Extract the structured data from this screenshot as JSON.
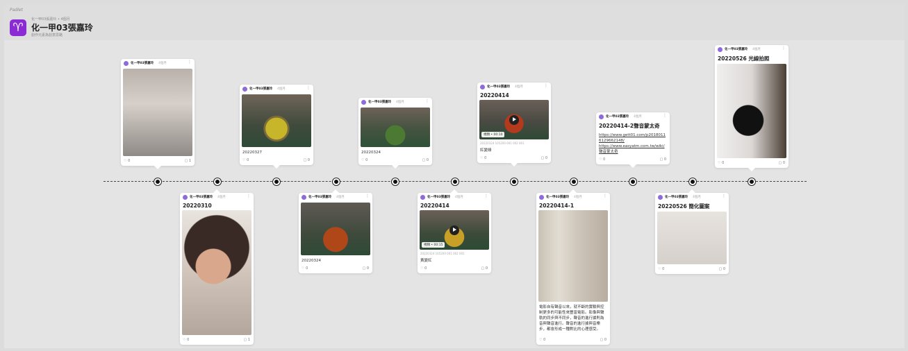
{
  "app": {
    "brand": "Padlet",
    "breadcrumb": "化一甲03張嘉玲 • 4個月",
    "title": "化一甲03張嘉玲",
    "subtitle": "創作元素為創意思路",
    "icon": "aries-icon",
    "icon_glyph": "♈",
    "accent_color": "#8b2bd6"
  },
  "post_common": {
    "author": "化一甲03張嘉玲",
    "time": "4個月",
    "more": "⋮"
  },
  "posts": [
    {
      "title": "",
      "caption": "",
      "likes": "0",
      "comments": "1"
    },
    {
      "title": "20220310",
      "caption": "",
      "likes": "0",
      "comments": "1"
    },
    {
      "title": "",
      "caption": "20220327",
      "likes": "0",
      "comments": "0"
    },
    {
      "title": "",
      "caption": "20220324",
      "likes": "0",
      "comments": "0"
    },
    {
      "title": "",
      "caption": "20220324",
      "likes": "0",
      "comments": "0"
    },
    {
      "title": "20220414",
      "video_meta": "視頻 • 00:15",
      "sub": "20220324 105200 001 002 001",
      "caption": "黃變紅",
      "likes": "0",
      "comments": "0"
    },
    {
      "title": "20220414",
      "video_meta": "視頻 • 00:10",
      "sub": "20220324 105200 001 002 001",
      "caption": "紅變綠",
      "likes": "0",
      "comments": "0"
    },
    {
      "title": "20220414-1",
      "caption": "電影自有聲音以來，就不斷的實驗與控制更多的可能性來豐富電影。影像與聲軌的同步與不同步，聲音的進行據則為音與聲音進行。聲音的進行據與音樂步，都會形成一種對比的心理感受。",
      "likes": "0",
      "comments": "0"
    },
    {
      "title": "20220414-2聲音蒙太奇",
      "links": [
        "https://www.gett01.com/p2018011 6129662148/",
        "https://www.easyatm.com.tw/wiki/ 聲音蒙太奇"
      ],
      "likes": "0",
      "comments": "0"
    },
    {
      "title": "20220526 簡化圖案",
      "caption": "",
      "likes": "0",
      "comments": "0"
    },
    {
      "title": "20220526 光線拍照",
      "caption": "",
      "likes": "0",
      "comments": "0"
    }
  ],
  "icons": {
    "like": "heart-icon",
    "comment": "comment-icon",
    "play": "play-icon",
    "more": "more-icon"
  }
}
